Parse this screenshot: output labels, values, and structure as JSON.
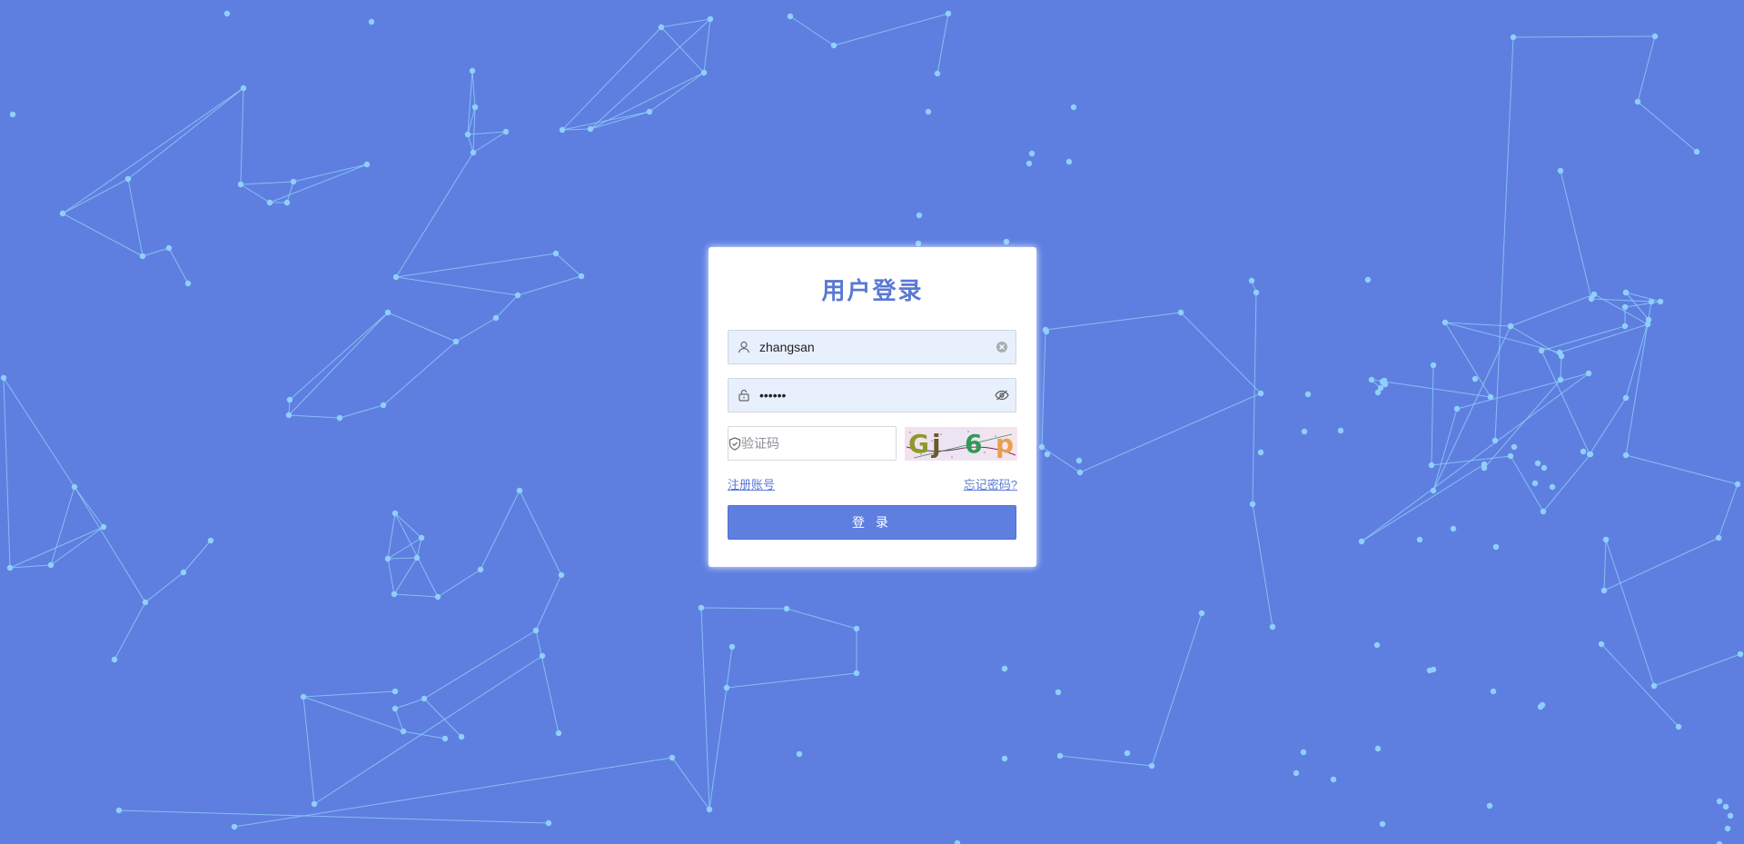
{
  "login": {
    "title": "用户登录",
    "username": {
      "value": "zhangsan",
      "placeholder": ""
    },
    "password": {
      "value": "••••••",
      "placeholder": ""
    },
    "captcha": {
      "value": "",
      "placeholder": "验证码",
      "image_text": [
        "G",
        "j",
        "6",
        "p"
      ]
    },
    "register_link": "注册账号",
    "forgot_link": "忘记密码?",
    "submit_label": "登 录"
  },
  "colors": {
    "background": "#5e7fe0",
    "accent": "#5a78d4",
    "particle": "#8fcaf7",
    "input_fill": "#e8effd"
  },
  "icons": {
    "username": "user-icon",
    "password": "lock-icon",
    "clear": "clear-circle-icon",
    "reveal": "eye-icon",
    "captcha": "shield-icon"
  }
}
